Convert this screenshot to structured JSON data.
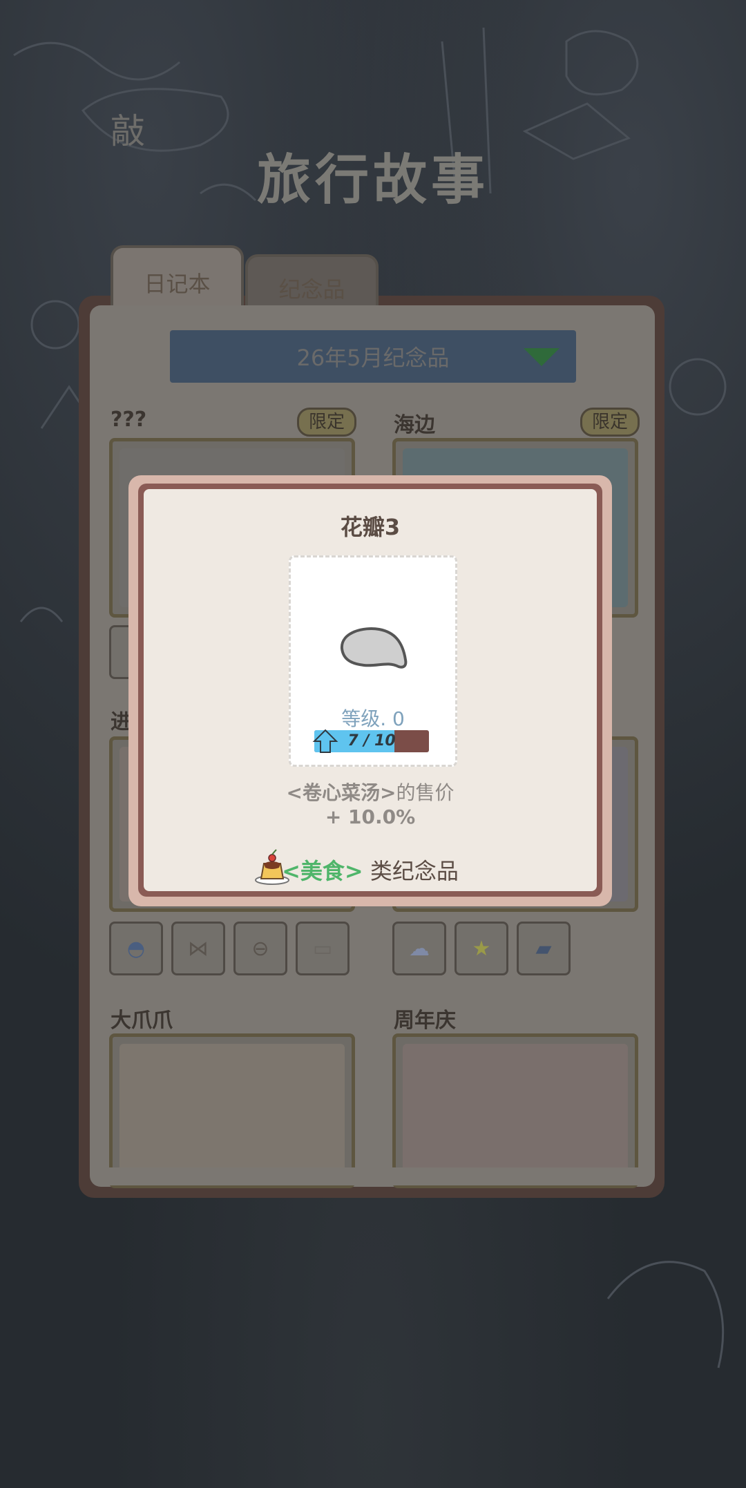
{
  "header": {
    "title": "旅行故事",
    "corner_char": "敲"
  },
  "tabs": [
    {
      "label": "日记本",
      "active": true
    },
    {
      "label": "纪念品",
      "active": false
    }
  ],
  "month_selector": {
    "value": "26年5月纪念品"
  },
  "cards": [
    {
      "title": "???",
      "badge": "限定"
    },
    {
      "title": "海边",
      "badge": "限定"
    },
    {
      "title": "进"
    },
    {
      "title": "大爪爪"
    },
    {
      "title": "周年庆"
    }
  ],
  "dialog": {
    "item_name": "花瓣3",
    "level_label": "等级. 0",
    "progress_text": "7 / 10",
    "progress_current": 7,
    "progress_max": 10,
    "price_item": "<卷心菜汤>",
    "price_suffix": "的售价",
    "bonus": "+ 10.0%",
    "category_tag": "<美食>",
    "category_suffix": " 类纪念品"
  },
  "colors": {
    "accent_green": "#4fb56a",
    "progress_blue": "#5fc4ef",
    "dialog_bg": "#efe9e2"
  }
}
